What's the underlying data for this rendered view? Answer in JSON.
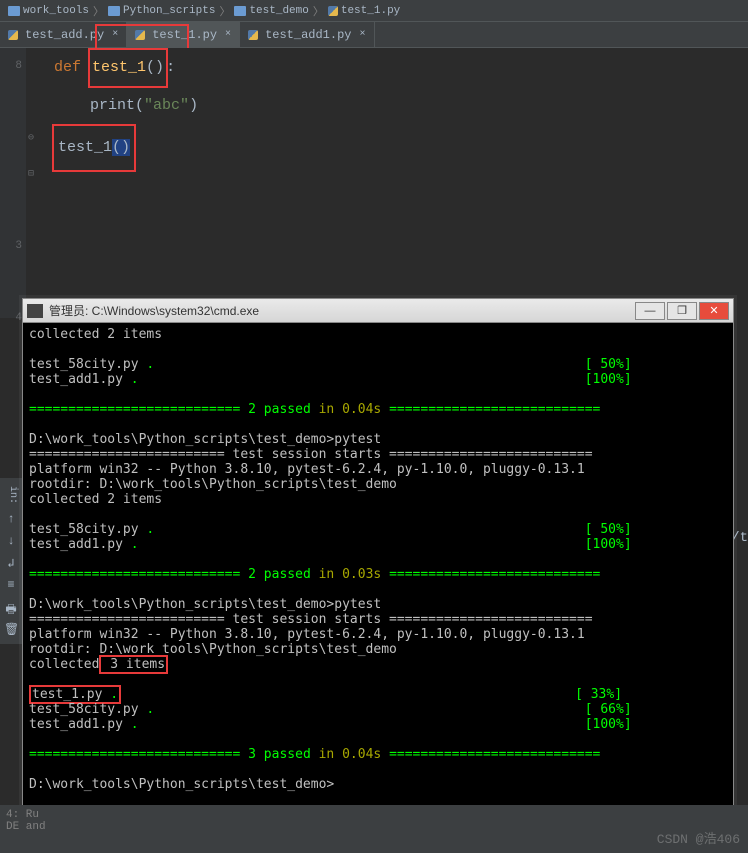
{
  "breadcrumb": {
    "items": [
      "work_tools",
      "Python_scripts",
      "test_demo",
      "test_1.py"
    ]
  },
  "tabs": [
    {
      "label": "test_add.py",
      "active": false
    },
    {
      "label": "test_1.py",
      "active": true
    },
    {
      "label": "test_add1.py",
      "active": false
    }
  ],
  "gutter_numbers": [
    "8",
    "",
    "",
    "",
    "",
    "3",
    "",
    "4"
  ],
  "code": {
    "def_kw": "def",
    "fn_name": "test_1",
    "fn_parens": "()",
    "colon": ":",
    "print_fn": "print",
    "print_arg": "\"abc\"",
    "call_name": "test_1",
    "call_parens": "()"
  },
  "cmd": {
    "title": "管理员: C:\\Windows\\system32\\cmd.exe",
    "min": "—",
    "max": "❐",
    "close": "✕",
    "lines": {
      "collected2": "collected 2 items",
      "tf58": "test_58city.py ",
      "tf58dot": ".",
      "tf58pct": "[ 50%]",
      "tfadd1": "test_add1.py ",
      "tfadd1dot": ".",
      "tfadd1pct": "[100%]",
      "sep_eq": "===========================",
      "passed2a": " 2 passed ",
      "in004": "in 0.04s ",
      "sep_eq2": "===========================",
      "prompt1": "D:\\work_tools\\Python_scripts\\test_demo>pytest",
      "sess_start": "========================= test session starts ==========================",
      "platform": "platform win32 -- Python 3.8.10, pytest-6.2.4, py-1.10.0, pluggy-0.13.1",
      "rootdir": "rootdir: D:\\work_tools\\Python_scripts\\test_demo",
      "passed2b": " 2 passed ",
      "in003": "in 0.03s ",
      "prompt2": "D:\\work_tools\\Python_scripts\\test_demo>pytest",
      "collected": "collected",
      "items3": " 3 items",
      "tf1": "test_1.py ",
      "tf1dot": ".",
      "tf1pct": "[ 33%]",
      "tf58b": "test_58city.py ",
      "tf58bdot": ".",
      "tf58bpct": "[ 66%]",
      "tfadd1b": "test_add1.py ",
      "tfadd1bdot": ".",
      "tfadd1bpct": "[100%]",
      "passed3": " 3 passed ",
      "in004b": "in 0.04s ",
      "prompt3": "D:\\work_tools\\Python_scripts\\test_demo>"
    }
  },
  "status": {
    "line1": "4: Ru",
    "line2": "DE and"
  },
  "right_crop": "ts/t",
  "watermark": "CSDN @浩406",
  "side_label": "in:"
}
